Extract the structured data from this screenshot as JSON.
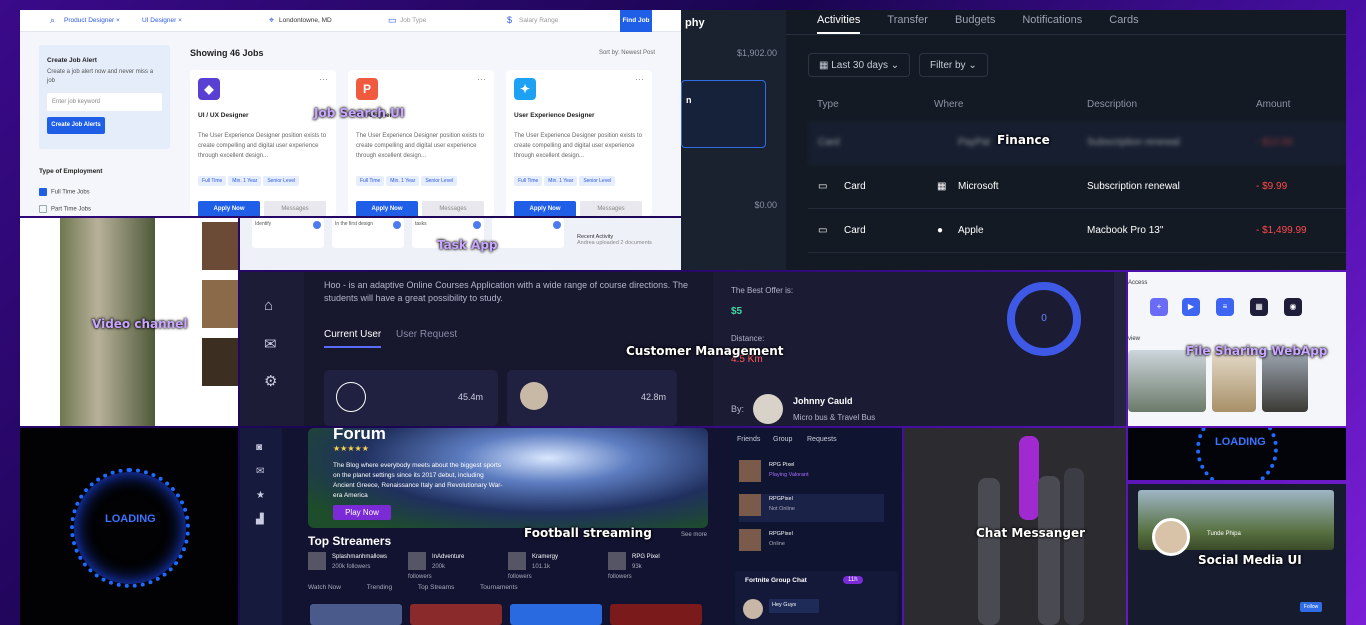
{
  "captions": {
    "job": "Job Search UI",
    "finance": "Finance",
    "video": "Video channel",
    "task": "Task App",
    "customer": "Customer Management",
    "file": "File Sharing WebApp",
    "football": "Football streaming",
    "chat": "Chat Messanger",
    "social": "Social Media UI"
  },
  "job": {
    "chips": [
      "Product Designer ×",
      "UI Designer ×"
    ],
    "location": "Londontowne, MD",
    "job_type": "Job Type",
    "salary": "Salary Range",
    "find": "Find Job",
    "alert_title": "Create Job Alert",
    "alert_text": "Create a job alert now and never miss a job",
    "alert_placeholder": "Enter job keyword",
    "alert_button": "Create Job Alerts",
    "employment_title": "Type of Employment",
    "employment": [
      "Full Time Jobs",
      "Part Time Jobs"
    ],
    "showing": "Showing 46 Jobs",
    "sort": "Sort by: Newest Post",
    "cards": [
      {
        "title": "UI / UX Designer",
        "color": "#5a3fd3",
        "glyph": "◆"
      },
      {
        "title": "UI Designer",
        "color": "#f05a3e",
        "glyph": "P"
      },
      {
        "title": "User Experience Designer",
        "color": "#1da1f2",
        "glyph": "✦"
      }
    ],
    "card_text": "The User Experience Designer position exists to create compelling and digital user experience through excellent design...",
    "tags": [
      "Full Time",
      "Min. 1 Year",
      "Senior Level"
    ],
    "apply": "Apply Now",
    "messages": "Messages"
  },
  "finance": {
    "left_title": "phy",
    "left_amount1": "$1,902.00",
    "left_box": "n",
    "left_amount2": "$0.00",
    "tabs": [
      "Activities",
      "Transfer",
      "Budgets",
      "Notifications",
      "Cards"
    ],
    "filter1": "Last 30 days",
    "filter2": "Filter by",
    "headers": [
      "Type",
      "Where",
      "Description",
      "Amount"
    ],
    "rows": [
      {
        "type": "Card",
        "where": "PayPal",
        "desc": "Subscription renewal",
        "amount": "- $10.00"
      },
      {
        "type": "Card",
        "where": "Microsoft",
        "desc": "Subscription renewal",
        "amount": "- $9.99"
      },
      {
        "type": "Card",
        "where": "Apple",
        "desc": "Macbook Pro 13\"",
        "amount": "- $1,499.99"
      }
    ]
  },
  "task": {
    "card_text": [
      "Identify",
      "In the first design",
      "tasks"
    ],
    "recent": "Recent Activity",
    "recent_name": "Andrea uploaded 2 documents"
  },
  "customer": {
    "description": "Hoo - is an adaptive Online Courses Application with a wide range of course directions. The students will have a great possibility to study.",
    "tab_current": "Current User",
    "tab_request": "User Request",
    "dist1": "45.4m",
    "dist2": "42.8m",
    "offer_label": "The Best Offer is:",
    "offer_value": "$5",
    "distance_label": "Distance:",
    "distance_value": "4.5 Km",
    "by": "By:",
    "driver": "Johnny Cauld",
    "vehicle": "Micro bus & Travel Bus",
    "progress": "0"
  },
  "file": {
    "access": "Access",
    "icons": [
      "New",
      "Video",
      "Docs",
      "Files",
      "Apps",
      "Music"
    ],
    "view": "view"
  },
  "loading": "LOADING",
  "football": {
    "forum": "Forum",
    "stars": "★★★★★",
    "blurb": "The Blog where everybody meets about the biggest sports on the planet settings since its 2017 debut, including Ancient Greece, Renaissance Italy and Revolutionary War-era America",
    "play": "Play Now",
    "top": "Top Streamers",
    "see_all": "See more",
    "streamers": [
      {
        "name": "Splashmanhmallows",
        "followers": "200k followers"
      },
      {
        "name": "InAdventure",
        "followers": "200k followers"
      },
      {
        "name": "Kramergy",
        "followers": "101.1k followers"
      },
      {
        "name": "RPG Pixel",
        "followers": "93k followers"
      }
    ],
    "tabs": [
      "Watch Now",
      "Trending",
      "Top Streams",
      "Tournaments"
    ],
    "friend_tabs": [
      "Friends",
      "Group",
      "Requests"
    ],
    "friends": [
      {
        "name": "RPG Pixel",
        "status": "Playing Valorant"
      },
      {
        "name": "RPGPixel",
        "status": "Not Online"
      },
      {
        "name": "RPGPixel",
        "status": "Online"
      }
    ],
    "group": "Fortnite Group Chat",
    "group_count": "11h",
    "group_msg": "Hey Guys"
  },
  "social": {
    "name": "Tunde Phipa",
    "follow": "Follow"
  }
}
